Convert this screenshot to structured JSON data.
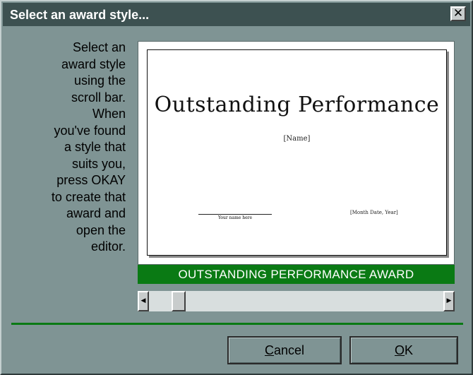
{
  "window": {
    "title": "Select an award style...",
    "close_glyph": "✕"
  },
  "instructions": [
    "Select an",
    "award style",
    "using the",
    "scroll bar.",
    "When",
    "you've found",
    "a style that",
    "suits you,",
    "press OKAY",
    "to create that",
    "award and",
    "open the",
    "editor."
  ],
  "preview": {
    "certificate_title": "Outstanding Performance",
    "name_placeholder": "[Name]",
    "date_placeholder": "[Month Date, Year]",
    "signature_line": "Your name here",
    "style_label": "OUTSTANDING PERFORMANCE AWARD"
  },
  "scrollbar": {
    "left_arrow": "◀",
    "right_arrow": "▶",
    "position": 0.08
  },
  "buttons": {
    "cancel_mnemonic": "C",
    "cancel_rest": "ancel",
    "ok_mnemonic": "O",
    "ok_rest": "K"
  },
  "colors": {
    "title_bar": "#3d5151",
    "dialog_bg": "#7f9494",
    "accent_green": "#0a7a14"
  }
}
